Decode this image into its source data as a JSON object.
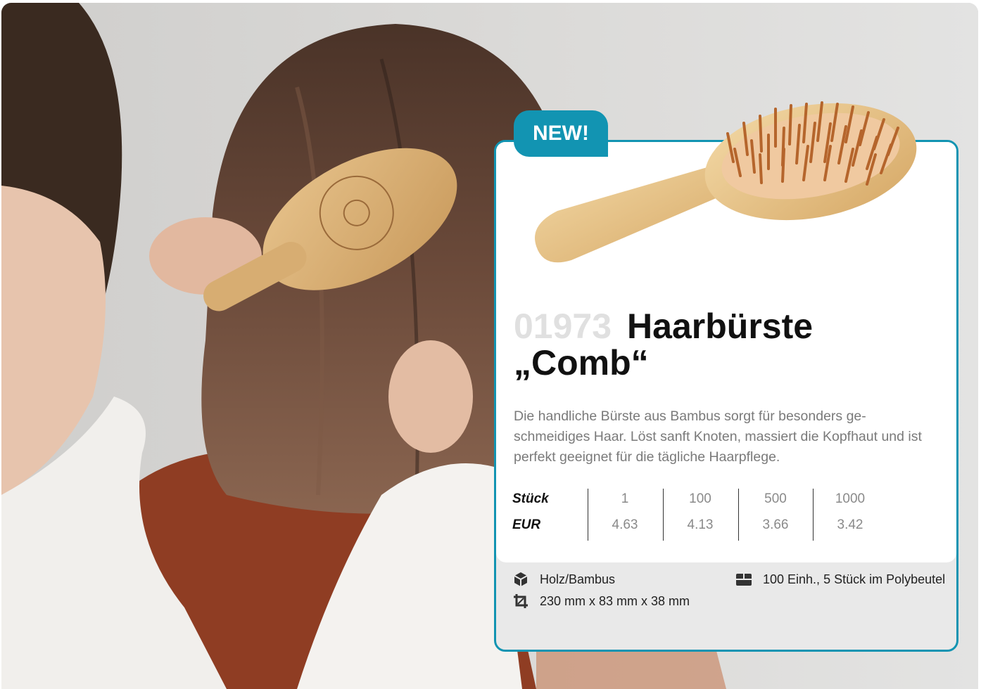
{
  "badge": {
    "label": "NEW!"
  },
  "product": {
    "article_number": "01973",
    "name_line1": "Haarbürste",
    "name_line2": "„Comb“",
    "description": "Die handliche Bürste aus Bambus sorgt für besonders ge-schmeidiges Haar. Löst sanft Knoten, massiert die Kopfhaut und ist perfekt geeignet für die tägliche Haarpflege."
  },
  "price_table": {
    "qty_label": "Stück",
    "price_label": "EUR",
    "quantities": [
      "1",
      "100",
      "500",
      "1000"
    ],
    "prices": [
      "4.63",
      "4.13",
      "3.66",
      "3.42"
    ]
  },
  "specs": {
    "material": {
      "icon": "material-box-icon",
      "text": "Holz/Bambus"
    },
    "dimensions": {
      "icon": "crop-dimensions-icon",
      "text": "230 mm x 83 mm x 38 mm"
    },
    "packaging": {
      "icon": "packaging-box-icon",
      "text": "100 Einh., 5 Stück im Polybeutel"
    }
  },
  "colors": {
    "accent": "#1294b2",
    "card_footer": "#e9e9e9",
    "article_number": "#e0e0e0"
  }
}
